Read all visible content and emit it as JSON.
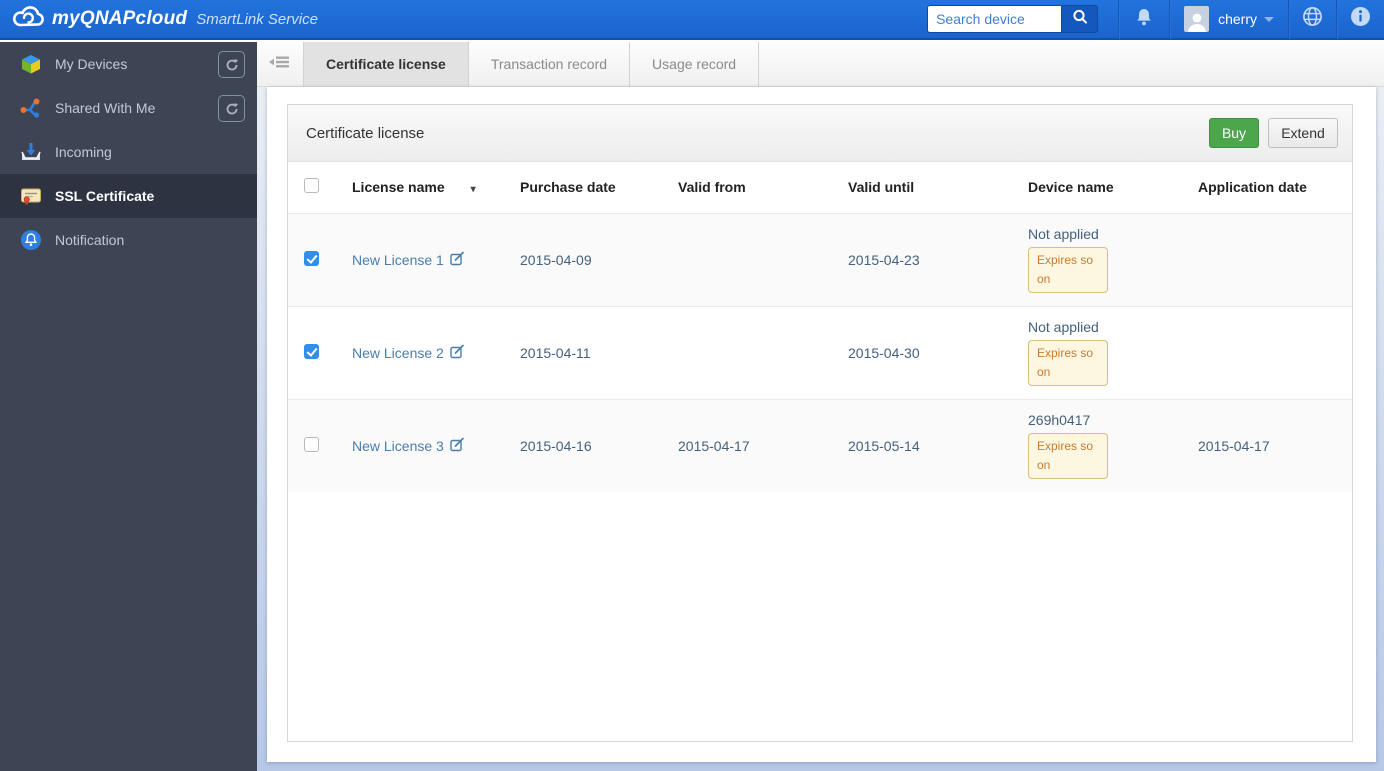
{
  "header": {
    "logo_title": "myQNAPcloud",
    "logo_subtitle": "SmartLink Service",
    "search": {
      "placeholder": "Search device"
    },
    "user": {
      "name": "cherry"
    }
  },
  "sidebar": {
    "items": [
      {
        "label": "My Devices",
        "icon": "devices-cube-icon",
        "has_refresh": true,
        "active": false
      },
      {
        "label": "Shared With Me",
        "icon": "share-icon",
        "has_refresh": true,
        "active": false
      },
      {
        "label": "Incoming",
        "icon": "incoming-tray-icon",
        "has_refresh": false,
        "active": false
      },
      {
        "label": "SSL Certificate",
        "icon": "certificate-icon",
        "has_refresh": false,
        "active": true
      },
      {
        "label": "Notification",
        "icon": "notification-bell-icon",
        "has_refresh": false,
        "active": false
      }
    ]
  },
  "tabs": [
    {
      "label": "Certificate license",
      "active": true
    },
    {
      "label": "Transaction record",
      "active": false
    },
    {
      "label": "Usage record",
      "active": false
    }
  ],
  "panel": {
    "title": "Certificate license",
    "buy_label": "Buy",
    "extend_label": "Extend"
  },
  "table": {
    "columns": [
      "License name",
      "Purchase date",
      "Valid from",
      "Valid until",
      "Device name",
      "Application date"
    ],
    "rows": [
      {
        "checked": true,
        "license_name": "New License 1",
        "purchase_date": "2015-04-09",
        "valid_from": "",
        "valid_until": "2015-04-23",
        "device_name": "Not applied",
        "device_status": "Expires soon",
        "application_date": ""
      },
      {
        "checked": true,
        "license_name": "New License 2",
        "purchase_date": "2015-04-11",
        "valid_from": "",
        "valid_until": "2015-04-30",
        "device_name": "Not applied",
        "device_status": "Expires soon",
        "application_date": ""
      },
      {
        "checked": false,
        "license_name": "New License 3",
        "purchase_date": "2015-04-16",
        "valid_from": "2015-04-17",
        "valid_until": "2015-05-14",
        "device_name": "269h0417",
        "device_status": "Expires soon",
        "application_date": "2015-04-17"
      }
    ]
  },
  "colors": {
    "header_blue": "#1b64cd",
    "sidebar_bg": "#3d4454",
    "sidebar_active_bg": "#2d3340",
    "accent_link": "#4a7dad",
    "date_text": "#45607c",
    "buy_green": "#4ca64c",
    "badge_bg": "#fdf6e0",
    "badge_border": "#dcbe80",
    "badge_text": "#c87c30",
    "checkbox_checked": "#2f8feb"
  }
}
